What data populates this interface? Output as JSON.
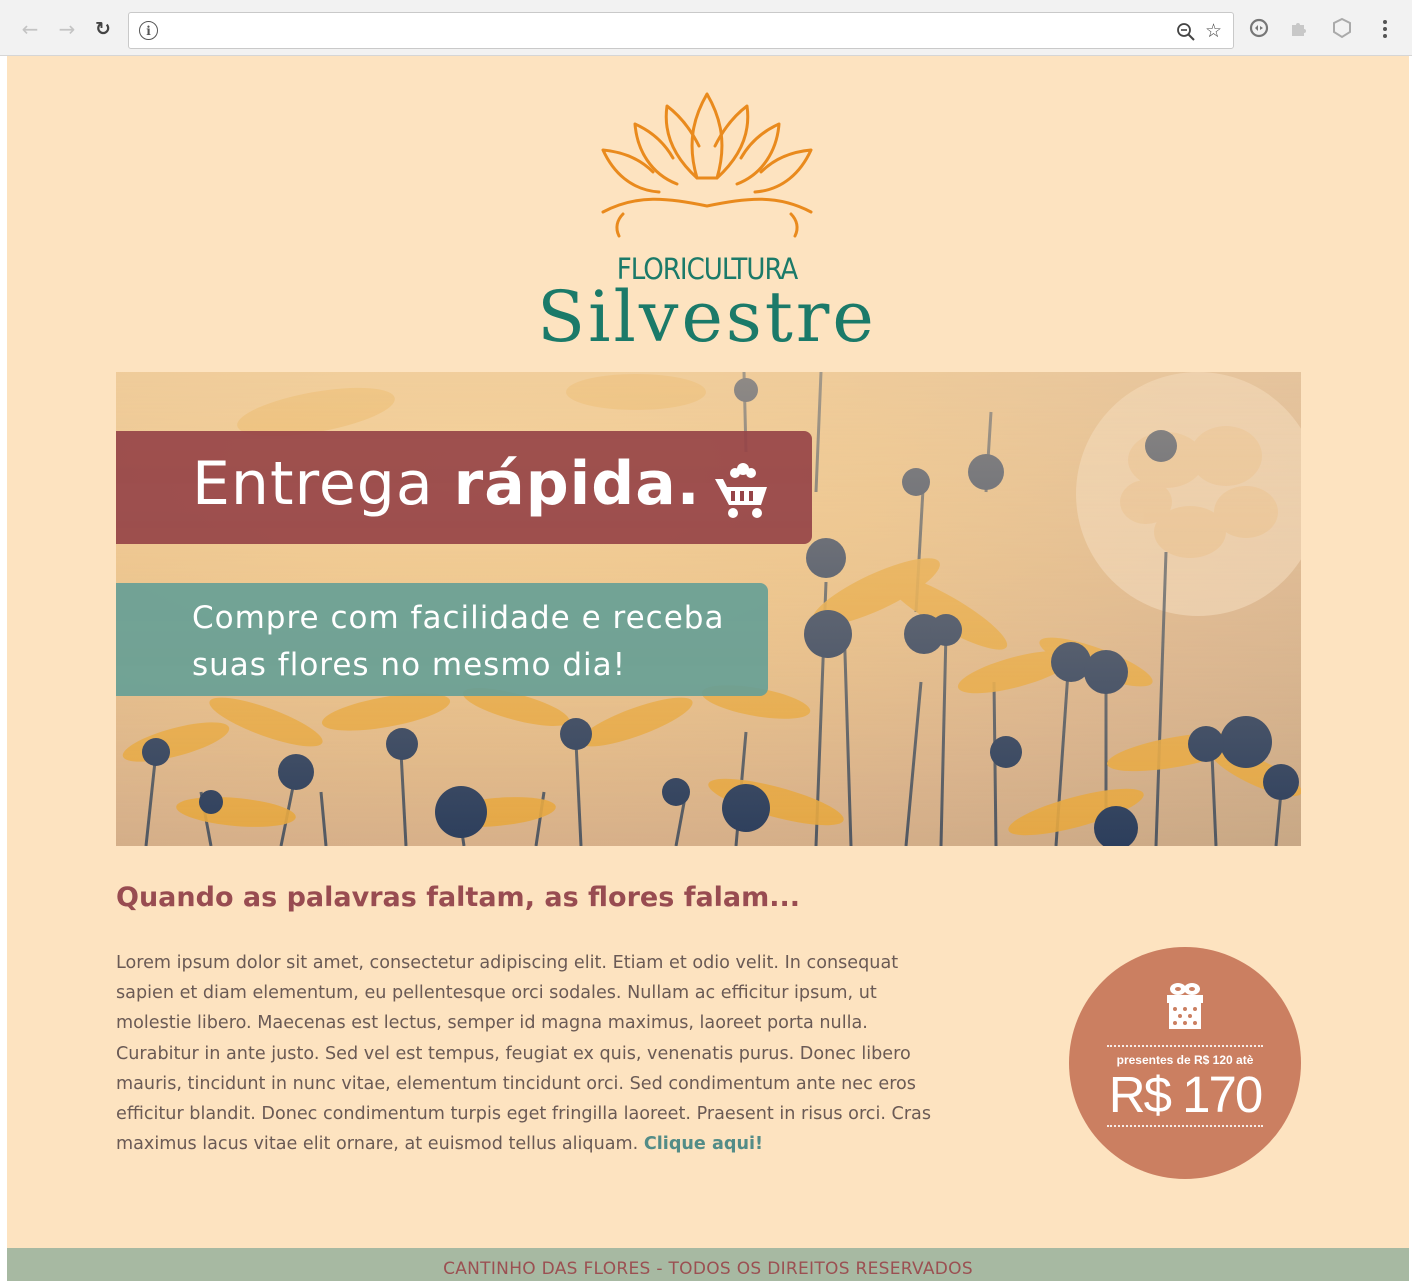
{
  "browser": {
    "back_icon": "arrow-left-icon",
    "forward_icon": "arrow-right-icon",
    "reload_icon": "reload-icon",
    "info_symbol": "i",
    "url_value": "",
    "zoom_icon": "zoom-out-icon",
    "bookmark_icon": "star-icon",
    "menu_icon": "vertical-dots-icon"
  },
  "logo": {
    "top_text": "FLORICULTURA",
    "brand_name": "Silvestre",
    "colors": {
      "lotus": "#e98a1d",
      "text": "#1b7a69"
    }
  },
  "banner": {
    "headline_light": "Entrega ",
    "headline_bold": "rápida.",
    "subtitle": "Compre com facilidade e receba suas flores no mesmo dia!",
    "colors": {
      "red_box": "#964448",
      "teal_box": "#67a096"
    }
  },
  "content": {
    "heading": "Quando as palavras faltam, as flores falam...",
    "paragraph": "Lorem ipsum dolor sit amet, consectetur adipiscing elit. Etiam et odio velit. In consequat sapien et diam elementum, eu pellentesque orci sodales. Nullam ac efficitur ipsum, ut molestie libero. Maecenas est lectus, semper id magna maximus, laoreet porta nulla. Curabitur in ante justo. Sed vel est tempus, feugiat ex quis, venenatis purus. Donec libero mauris, tincidunt in nunc vitae, elementum tincidunt orci. Sed condimentum ante nec eros efficitur blandit. Donec condimentum turpis eget fringilla laoreet. Praesent in risus orci. Cras maximus lacus vitae elit ornare, at euismod tellus aliquam.",
    "link_text": "Clique aqui!"
  },
  "promo": {
    "small_text": "presentes de R$ 120 atè",
    "price": "R$ 170",
    "color": "#cb7f61"
  },
  "footer": {
    "text": "CANTINHO DAS FLORES - TODOS OS DIREITOS RESERVADOS"
  }
}
